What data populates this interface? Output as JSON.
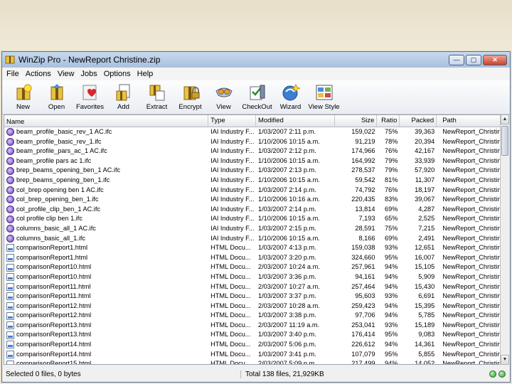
{
  "window": {
    "title": "WinZip Pro - NewReport Christine.zip",
    "minimize": "—",
    "maximize": "▢",
    "close": "✕"
  },
  "menu": [
    "File",
    "Actions",
    "View",
    "Jobs",
    "Options",
    "Help"
  ],
  "toolbar": [
    {
      "label": "New",
      "icon": "new-archive-icon"
    },
    {
      "label": "Open",
      "icon": "open-archive-icon"
    },
    {
      "label": "Favorites",
      "icon": "favorites-icon"
    },
    {
      "label": "Add",
      "icon": "add-icon"
    },
    {
      "label": "Extract",
      "icon": "extract-icon"
    },
    {
      "label": "Encrypt",
      "icon": "encrypt-icon"
    },
    {
      "label": "View",
      "icon": "view-icon"
    },
    {
      "label": "CheckOut",
      "icon": "checkout-icon"
    },
    {
      "label": "Wizard",
      "icon": "wizard-icon"
    },
    {
      "label": "View Style",
      "icon": "view-style-icon"
    }
  ],
  "columns": {
    "name": "Name",
    "type": "Type",
    "modified": "Modified",
    "size": "Size",
    "ratio": "Ratio",
    "packed": "Packed",
    "path": "Path"
  },
  "files": [
    {
      "name": "beam_profile_basic_rev_1 AC.ifc",
      "type": "IAI Industry F...",
      "modified": "1/03/2007 2:11 p.m.",
      "size": "159,022",
      "ratio": "75%",
      "packed": "39,363",
      "path": "NewReport_Christine\\IFC Te...",
      "kind": "ifc"
    },
    {
      "name": "beam_profile_basic_rev_1.ifc",
      "type": "IAI Industry F...",
      "modified": "1/10/2006 10:15 a.m.",
      "size": "91,219",
      "ratio": "78%",
      "packed": "20,394",
      "path": "NewReport_Christine\\IFC Te...",
      "kind": "ifc"
    },
    {
      "name": "beam_profile_pars_ac_1 AC.ifc",
      "type": "IAI Industry F...",
      "modified": "1/03/2007 2:12 p.m.",
      "size": "174,966",
      "ratio": "76%",
      "packed": "42,167",
      "path": "NewReport_Christine\\IFC Te...",
      "kind": "ifc"
    },
    {
      "name": "beam_profile pars ac 1.ifc",
      "type": "IAI Industry F...",
      "modified": "1/10/2006 10:15 a.m.",
      "size": "164,992",
      "ratio": "79%",
      "packed": "33,939",
      "path": "NewReport_Christine\\IFC Te...",
      "kind": "ifc"
    },
    {
      "name": "brep_beams_opening_ben_1 AC.ifc",
      "type": "IAI Industry F...",
      "modified": "1/03/2007 2:13 p.m.",
      "size": "278,537",
      "ratio": "79%",
      "packed": "57,920",
      "path": "NewReport_Christine\\IFC Te...",
      "kind": "ifc"
    },
    {
      "name": "brep_beams_opening_ben_1.ifc",
      "type": "IAI Industry F...",
      "modified": "1/10/2006 10:15 a.m.",
      "size": "59,542",
      "ratio": "81%",
      "packed": "11,307",
      "path": "NewReport_Christine\\IFC Te...",
      "kind": "ifc"
    },
    {
      "name": "col_brep opening ben 1 AC.ifc",
      "type": "IAI Industry F...",
      "modified": "1/03/2007 2:14 p.m.",
      "size": "74,792",
      "ratio": "76%",
      "packed": "18,197",
      "path": "NewReport_Christine\\IFC Te...",
      "kind": "ifc"
    },
    {
      "name": "col_brep_opening_ben_1.ifc",
      "type": "IAI Industry F...",
      "modified": "1/10/2006 10:16 a.m.",
      "size": "220,435",
      "ratio": "83%",
      "packed": "39,067",
      "path": "NewReport_Christine\\IFC Te...",
      "kind": "ifc"
    },
    {
      "name": "col_profile_clip_ben_1 AC.ifc",
      "type": "IAI Industry F...",
      "modified": "1/03/2007 2:14 p.m.",
      "size": "13,814",
      "ratio": "69%",
      "packed": "4,287",
      "path": "NewReport_Christine\\IFC Te...",
      "kind": "ifc"
    },
    {
      "name": "col profile clip ben 1.ifc",
      "type": "IAI Industry F...",
      "modified": "1/10/2006 10:15 a.m.",
      "size": "7,193",
      "ratio": "65%",
      "packed": "2,525",
      "path": "NewReport_Christine\\IFC Te...",
      "kind": "ifc"
    },
    {
      "name": "columns_basic_all_1 AC.ifc",
      "type": "IAI Industry F...",
      "modified": "1/03/2007 2:15 p.m.",
      "size": "28,591",
      "ratio": "75%",
      "packed": "7,215",
      "path": "NewReport_Christine\\IFC Te...",
      "kind": "ifc"
    },
    {
      "name": "columns_basic_all_1.ifc",
      "type": "IAI Industry F...",
      "modified": "1/10/2006 10:15 a.m.",
      "size": "8,166",
      "ratio": "69%",
      "packed": "2,491",
      "path": "NewReport_Christine\\IFC Te...",
      "kind": "ifc"
    },
    {
      "name": "comparisonReport1.html",
      "type": "HTML Docu...",
      "modified": "1/03/2007 4:13 p.m.",
      "size": "159,038",
      "ratio": "93%",
      "packed": "12,651",
      "path": "NewReport_Christine\\NEW_...",
      "kind": "html"
    },
    {
      "name": "comparisonReport1.html",
      "type": "HTML Docu...",
      "modified": "1/03/2007 3:20 p.m.",
      "size": "324,660",
      "ratio": "95%",
      "packed": "16,007",
      "path": "NewReport_Christine\\NEW_...",
      "kind": "html"
    },
    {
      "name": "comparisonReport10.html",
      "type": "HTML Docu...",
      "modified": "2/03/2007 10:24 a.m.",
      "size": "257,961",
      "ratio": "94%",
      "packed": "15,105",
      "path": "NewReport_Christine\\NEW_...",
      "kind": "html"
    },
    {
      "name": "comparisonReport10.html",
      "type": "HTML Docu...",
      "modified": "1/03/2007 3:36 p.m.",
      "size": "94,161",
      "ratio": "94%",
      "packed": "5,909",
      "path": "NewReport_Christine\\NEW_...",
      "kind": "html"
    },
    {
      "name": "comparisonReport11.html",
      "type": "HTML Docu...",
      "modified": "2/03/2007 10:27 a.m.",
      "size": "257,464",
      "ratio": "94%",
      "packed": "15,430",
      "path": "NewReport_Christine\\NEW_...",
      "kind": "html"
    },
    {
      "name": "comparisonReport11.html",
      "type": "HTML Docu...",
      "modified": "1/03/2007 3:37 p.m.",
      "size": "95,603",
      "ratio": "93%",
      "packed": "6,691",
      "path": "NewReport_Christine\\NEW_...",
      "kind": "html"
    },
    {
      "name": "comparisonReport12.html",
      "type": "HTML Docu...",
      "modified": "2/03/2007 10:28 a.m.",
      "size": "259,423",
      "ratio": "94%",
      "packed": "15,395",
      "path": "NewReport_Christine\\NEW_...",
      "kind": "html"
    },
    {
      "name": "comparisonReport12.html",
      "type": "HTML Docu...",
      "modified": "1/03/2007 3:38 p.m.",
      "size": "97,706",
      "ratio": "94%",
      "packed": "5,785",
      "path": "NewReport_Christine\\NEW_...",
      "kind": "html"
    },
    {
      "name": "comparisonReport13.html",
      "type": "HTML Docu...",
      "modified": "2/03/2007 11:19 a.m.",
      "size": "253,041",
      "ratio": "93%",
      "packed": "15,189",
      "path": "NewReport_Christine\\NEW_...",
      "kind": "html"
    },
    {
      "name": "comparisonReport13.html",
      "type": "HTML Docu...",
      "modified": "1/03/2007 3:40 p.m.",
      "size": "176,414",
      "ratio": "95%",
      "packed": "9,083",
      "path": "NewReport_Christine\\NEW_...",
      "kind": "html"
    },
    {
      "name": "comparisonReport14.html",
      "type": "HTML Docu...",
      "modified": "2/03/2007 5:06 p.m.",
      "size": "226,612",
      "ratio": "94%",
      "packed": "14,361",
      "path": "NewReport_Christine\\NEW_...",
      "kind": "html"
    },
    {
      "name": "comparisonReport14.html",
      "type": "HTML Docu...",
      "modified": "1/03/2007 3:41 p.m.",
      "size": "107,079",
      "ratio": "95%",
      "packed": "5,855",
      "path": "NewReport_Christine\\NEW_...",
      "kind": "html"
    },
    {
      "name": "comparisonReport15.html",
      "type": "HTML Docu...",
      "modified": "2/03/2007 5:09 p.m.",
      "size": "217,499",
      "ratio": "94%",
      "packed": "14,052",
      "path": "NewReport_Christine\\NEW_...",
      "kind": "html"
    }
  ],
  "status": {
    "left": "Selected 0 files, 0 bytes",
    "right": "Total 138 files, 21,929KB"
  }
}
